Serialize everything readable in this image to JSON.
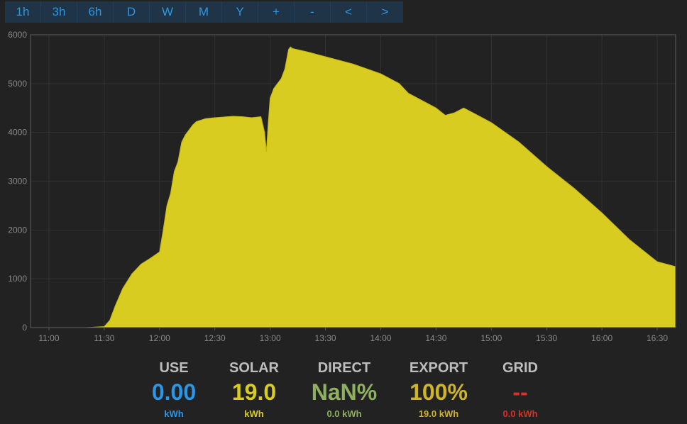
{
  "toolbar": {
    "buttons": [
      "1h",
      "3h",
      "6h",
      "D",
      "W",
      "M",
      "Y",
      "+",
      "-",
      "<",
      ">"
    ]
  },
  "colors": {
    "background": "#222222",
    "accent_blue": "#2b96e6",
    "solar_yellow": "#d9cc20",
    "direct_green": "#8fb05e",
    "grid_red": "#d9302a"
  },
  "chart_data": {
    "type": "area",
    "xlabel": "",
    "ylabel": "",
    "x_ticks": [
      "11:00",
      "11:30",
      "12:00",
      "12:30",
      "13:00",
      "13:30",
      "14:00",
      "14:30",
      "15:00",
      "15:30",
      "16:00",
      "16:30"
    ],
    "y_ticks": [
      "0",
      "1000",
      "2000",
      "3000",
      "4000",
      "5000",
      "6000"
    ],
    "xlim": [
      "10:50",
      "16:40"
    ],
    "ylim": [
      0,
      6000
    ],
    "grid": true,
    "series": [
      {
        "color": "#d9cc20",
        "x": [
          "10:50",
          "11:20",
          "11:30",
          "11:33",
          "11:36",
          "11:40",
          "11:45",
          "11:50",
          "11:55",
          "12:00",
          "12:02",
          "12:04",
          "12:06",
          "12:08",
          "12:10",
          "12:12",
          "12:14",
          "12:16",
          "12:18",
          "12:20",
          "12:25",
          "12:30",
          "12:40",
          "12:45",
          "12:50",
          "12:55",
          "12:57",
          "12:58",
          "12:59",
          "13:00",
          "13:02",
          "13:04",
          "13:06",
          "13:08",
          "13:10",
          "13:11",
          "13:12",
          "13:20",
          "13:30",
          "13:45",
          "14:00",
          "14:10",
          "14:15",
          "14:20",
          "14:30",
          "14:35",
          "14:40",
          "14:45",
          "14:50",
          "15:00",
          "15:15",
          "15:30",
          "15:45",
          "16:00",
          "16:15",
          "16:30",
          "16:40"
        ],
        "y": [
          0,
          0,
          20,
          150,
          450,
          800,
          1100,
          1300,
          1420,
          1550,
          2000,
          2500,
          2750,
          3200,
          3400,
          3800,
          3950,
          4050,
          4150,
          4220,
          4280,
          4300,
          4330,
          4320,
          4300,
          4320,
          4000,
          3600,
          4200,
          4700,
          4900,
          5000,
          5100,
          5300,
          5700,
          5750,
          5720,
          5650,
          5550,
          5400,
          5200,
          5000,
          4800,
          4700,
          4500,
          4350,
          4400,
          4500,
          4400,
          4200,
          3800,
          3300,
          2850,
          2350,
          1800,
          1350,
          1250
        ]
      }
    ]
  },
  "stats": [
    {
      "label": "USE",
      "value": "0.00",
      "sub": "kWh",
      "color": "#2b96e6"
    },
    {
      "label": "SOLAR",
      "value": "19.0",
      "sub": "kWh",
      "color": "#d9cc20"
    },
    {
      "label": "DIRECT",
      "value": "NaN%",
      "sub": "0.0 kWh",
      "color": "#8fb05e"
    },
    {
      "label": "EXPORT",
      "value": "100%",
      "sub": "19.0 kWh",
      "color": "#cfb429"
    },
    {
      "label": "GRID",
      "value": "--",
      "sub": "0.0 kWh",
      "color": "#d9302a"
    }
  ]
}
